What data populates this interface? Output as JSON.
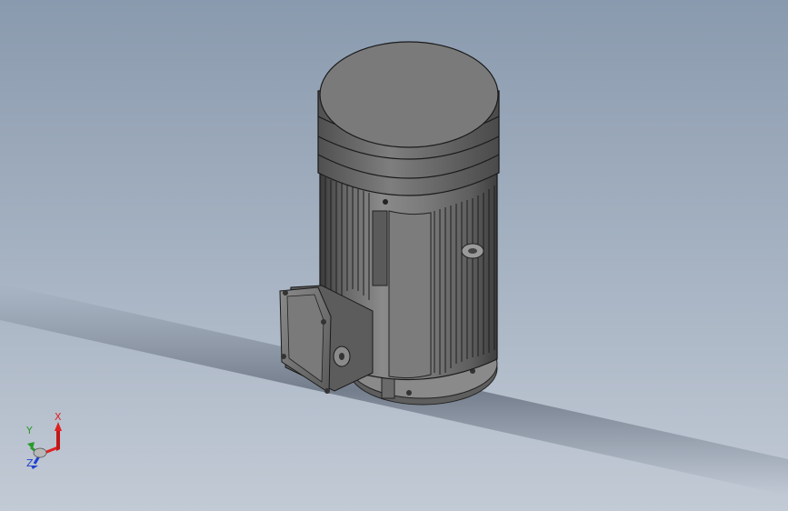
{
  "viewport": {
    "model": "motor-assembly",
    "background_top": "#8a9aae",
    "background_bottom": "#c2cad5"
  },
  "triad": {
    "x_label": "X",
    "y_label": "Y",
    "z_label": "Z",
    "x_color": "#e02020",
    "y_color": "#2a9a2a",
    "z_color": "#2040d0"
  }
}
